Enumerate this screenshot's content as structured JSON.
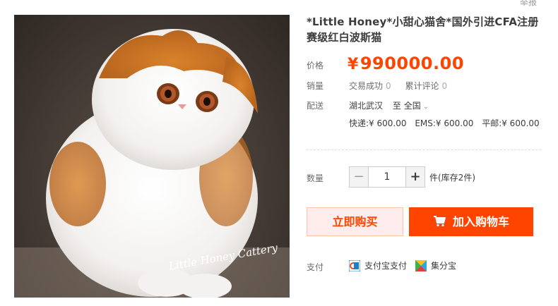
{
  "header": {
    "report_label": "举报"
  },
  "product": {
    "title": "*Little Honey*小甜心猫舍*国外引进CFA注册赛级红白波斯猫",
    "image_watermark": "Little Honey Cattery"
  },
  "price": {
    "label": "价格",
    "currency": "¥",
    "value": "990000.00"
  },
  "sales": {
    "label": "销量",
    "deals_label": "交易成功",
    "deals_count": "0",
    "reviews_label": "累计评论",
    "reviews_count": "0"
  },
  "shipping": {
    "label": "配送",
    "from": "湖北武汉",
    "to_word": "至",
    "destination": "全国",
    "fees": [
      "快递:¥ 600.00",
      "EMS:¥ 600.00",
      "平邮:¥ 600.00"
    ]
  },
  "quantity": {
    "label": "数量",
    "minus": "−",
    "value": "1",
    "plus": "+",
    "stock": "件(库存2件)"
  },
  "actions": {
    "buy_now": "立即购买",
    "add_to_cart": "加入购物车"
  },
  "payment": {
    "label": "支付",
    "methods": [
      "支付宝支付",
      "集分宝"
    ]
  },
  "colors": {
    "accent": "#ff4400",
    "buy_bg": "#ffeded"
  }
}
